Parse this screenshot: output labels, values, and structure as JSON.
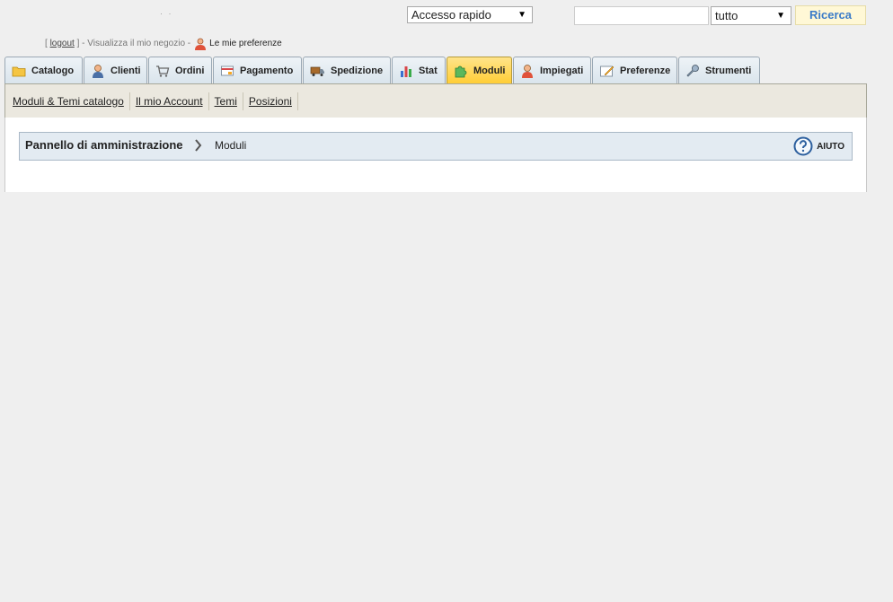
{
  "top": {
    "dots": "· ·",
    "quick_access": "Accesso rapido",
    "search_value": "",
    "search_scope": "tutto",
    "search_button": "Ricerca"
  },
  "header": {
    "bracket_open": "[",
    "logout": "logout",
    "bracket_close": "]",
    "view_shop": "- Visualizza il mio negozio -",
    "preferences": "Le mie preferenze"
  },
  "tabs": [
    {
      "label": "Catalogo",
      "icon": "folder-icon"
    },
    {
      "label": "Clienti",
      "icon": "customer-icon"
    },
    {
      "label": "Ordini",
      "icon": "cart-icon"
    },
    {
      "label": "Pagamento",
      "icon": "payment-icon"
    },
    {
      "label": "Spedizione",
      "icon": "truck-icon"
    },
    {
      "label": "Stat",
      "icon": "bar-chart-icon"
    },
    {
      "label": "Moduli",
      "icon": "puzzle-icon",
      "active": true
    },
    {
      "label": "Impiegati",
      "icon": "employee-icon"
    },
    {
      "label": "Preferenze",
      "icon": "preferences-icon"
    },
    {
      "label": "Strumenti",
      "icon": "wrench-icon"
    }
  ],
  "subnav": [
    "Moduli & Temi catalogo",
    "Il mio Account",
    "Temi",
    "Posizioni"
  ],
  "breadcrumb": {
    "root": "Pannello di amministrazione",
    "current": "Moduli"
  },
  "help": {
    "label": "AIUTO"
  },
  "colors": {
    "active_tab": "#ffcc33",
    "tab": "#d9e4ec",
    "subnav_bg": "#ebe8df",
    "breadcrumb_bg": "#e3ebf2",
    "search_button_text": "#3a7bc8"
  }
}
